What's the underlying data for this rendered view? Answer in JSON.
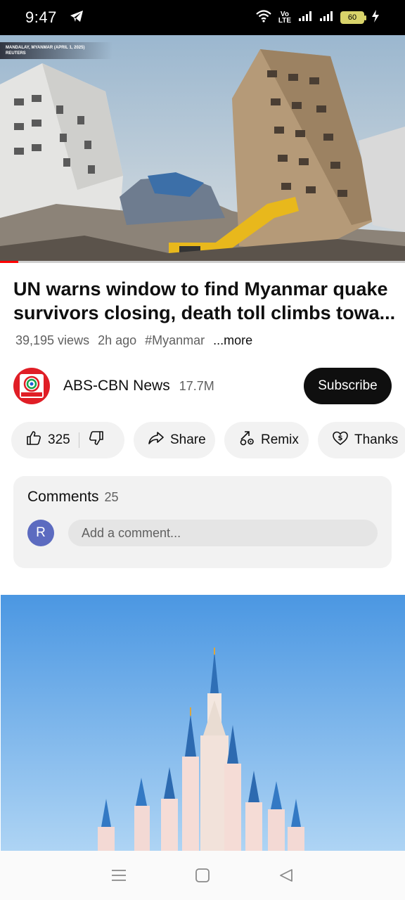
{
  "status_bar": {
    "time": "9:47",
    "volte_top": "Vo",
    "volte_bottom": "LTE",
    "battery": "60"
  },
  "video": {
    "caption_line1": "MANDALAY, MYANMAR (APRIL 1, 2025)",
    "caption_line2": "REUTERS",
    "progress": 0.045
  },
  "title": "UN warns window to find Myanmar quake survivors closing, death toll climbs towa...",
  "meta": {
    "views": "39,195 views",
    "age": "2h ago",
    "hashtag": "#Myanmar",
    "more": "...more"
  },
  "channel": {
    "name": "ABS-CBN News",
    "subscribers": "17.7M",
    "logo_text": "ABS-CBN NEWS",
    "subscribe_label": "Subscribe"
  },
  "actions": {
    "likes": "325",
    "share": "Share",
    "remix": "Remix",
    "thanks": "Thanks"
  },
  "comments": {
    "label": "Comments",
    "count": "25",
    "avatar_initial": "R",
    "placeholder": "Add a comment..."
  },
  "icons": {
    "telegram": "telegram-icon",
    "wifi": "wifi-icon",
    "signal": "signal-icon",
    "charging": "charging-icon",
    "like": "thumbs-up-icon",
    "dislike": "thumbs-down-icon",
    "share": "share-arrow-icon",
    "remix": "remix-icon",
    "thanks": "heart-dollar-icon",
    "menu": "menu-icon",
    "home": "home-square-icon",
    "back": "back-triangle-icon"
  },
  "colors": {
    "accent_red": "#ff0000",
    "subscribe_bg": "#0f0f0f",
    "chip_bg": "#f2f2f2",
    "avatar_bg": "#5c6bc0",
    "channel_logo": "#e01e26"
  }
}
